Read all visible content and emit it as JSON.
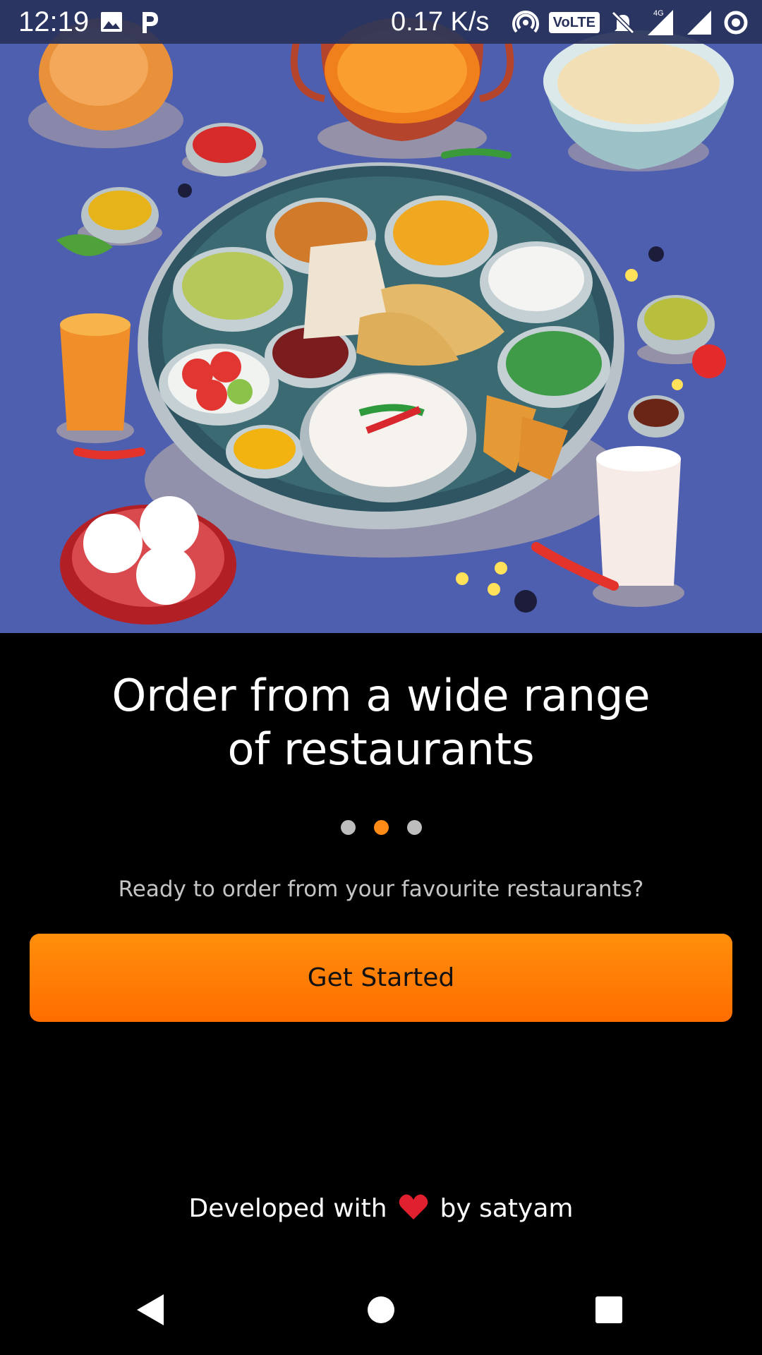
{
  "status_bar": {
    "time": "12:19",
    "network_speed": "0.17 K/s",
    "volte": "VoLTE",
    "network_type": "4G",
    "icons": [
      "image-icon",
      "parking-app-icon",
      "hotspot-icon",
      "volte-icon",
      "mute-icon",
      "signal-icon",
      "signal-icon-2",
      "sync-icon"
    ]
  },
  "hero": {
    "icon": "food-thali-illustration",
    "background_color": "#4f5fb0"
  },
  "onboarding": {
    "headline": "Order from a wide range\nof restaurants",
    "page_indicator": {
      "total": 3,
      "active_index": 1
    },
    "subtitle": "Ready to order from your favourite restaurants?",
    "cta_label": "Get Started",
    "accent_color": "#ff8a15"
  },
  "footer": {
    "prefix": "Developed with",
    "heart_icon": "heart-icon",
    "suffix": "by satyam"
  },
  "nav_bar": {
    "buttons": [
      "back-icon",
      "home-icon",
      "recents-icon"
    ]
  }
}
